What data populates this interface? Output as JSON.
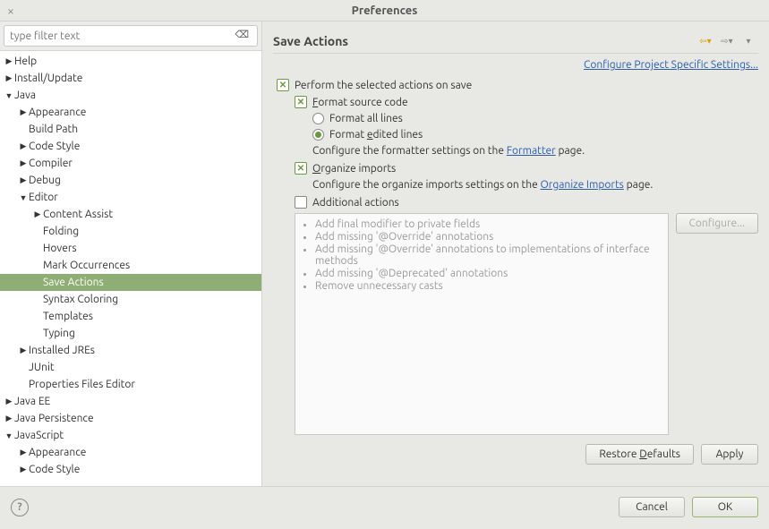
{
  "window": {
    "title": "Preferences"
  },
  "filter": {
    "placeholder": "type filter text"
  },
  "tree": [
    {
      "label": "Help",
      "level": 0,
      "exp": "▶",
      "sel": false
    },
    {
      "label": "Install/Update",
      "level": 0,
      "exp": "▶",
      "sel": false
    },
    {
      "label": "Java",
      "level": 0,
      "exp": "▼",
      "sel": false
    },
    {
      "label": "Appearance",
      "level": 1,
      "exp": "▶",
      "sel": false
    },
    {
      "label": "Build Path",
      "level": 1,
      "exp": "",
      "sel": false
    },
    {
      "label": "Code Style",
      "level": 1,
      "exp": "▶",
      "sel": false
    },
    {
      "label": "Compiler",
      "level": 1,
      "exp": "▶",
      "sel": false
    },
    {
      "label": "Debug",
      "level": 1,
      "exp": "▶",
      "sel": false
    },
    {
      "label": "Editor",
      "level": 1,
      "exp": "▼",
      "sel": false
    },
    {
      "label": "Content Assist",
      "level": 2,
      "exp": "▶",
      "sel": false
    },
    {
      "label": "Folding",
      "level": 2,
      "exp": "",
      "sel": false
    },
    {
      "label": "Hovers",
      "level": 2,
      "exp": "",
      "sel": false
    },
    {
      "label": "Mark Occurrences",
      "level": 2,
      "exp": "",
      "sel": false
    },
    {
      "label": "Save Actions",
      "level": 2,
      "exp": "",
      "sel": true
    },
    {
      "label": "Syntax Coloring",
      "level": 2,
      "exp": "",
      "sel": false
    },
    {
      "label": "Templates",
      "level": 2,
      "exp": "",
      "sel": false
    },
    {
      "label": "Typing",
      "level": 2,
      "exp": "",
      "sel": false
    },
    {
      "label": "Installed JREs",
      "level": 1,
      "exp": "▶",
      "sel": false
    },
    {
      "label": "JUnit",
      "level": 1,
      "exp": "",
      "sel": false
    },
    {
      "label": "Properties Files Editor",
      "level": 1,
      "exp": "",
      "sel": false
    },
    {
      "label": "Java EE",
      "level": 0,
      "exp": "▶",
      "sel": false
    },
    {
      "label": "Java Persistence",
      "level": 0,
      "exp": "▶",
      "sel": false
    },
    {
      "label": "JavaScript",
      "level": 0,
      "exp": "▼",
      "sel": false
    },
    {
      "label": "Appearance",
      "level": 1,
      "exp": "▶",
      "sel": false
    },
    {
      "label": "Code Style",
      "level": 1,
      "exp": "▶",
      "sel": false
    }
  ],
  "page": {
    "title": "Save Actions",
    "project_link": "Configure Project Specific Settings...",
    "perform_label": "Perform the selected actions on save",
    "format_label": "Format source code",
    "format_all": "Format all lines",
    "format_edited": "Format edited lines",
    "formatter_hint_pre": "Configure the formatter settings on the ",
    "formatter_link": "Formatter",
    "formatter_hint_post": " page.",
    "organize_label": "Organize imports",
    "organize_hint_pre": "Configure the organize imports settings on the ",
    "organize_link": "Organize Imports",
    "organize_hint_post": " page.",
    "additional_label": "Additional actions",
    "additional_items": [
      "Add final modifier to private fields",
      "Add missing '@Override' annotations",
      "Add missing '@Override' annotations to implementations of interface methods",
      "Add missing '@Deprecated' annotations",
      "Remove unnecessary casts"
    ],
    "configure_btn": "Configure...",
    "restore_btn": "Restore Defaults",
    "apply_btn": "Apply"
  },
  "footer": {
    "cancel": "Cancel",
    "ok": "OK"
  }
}
